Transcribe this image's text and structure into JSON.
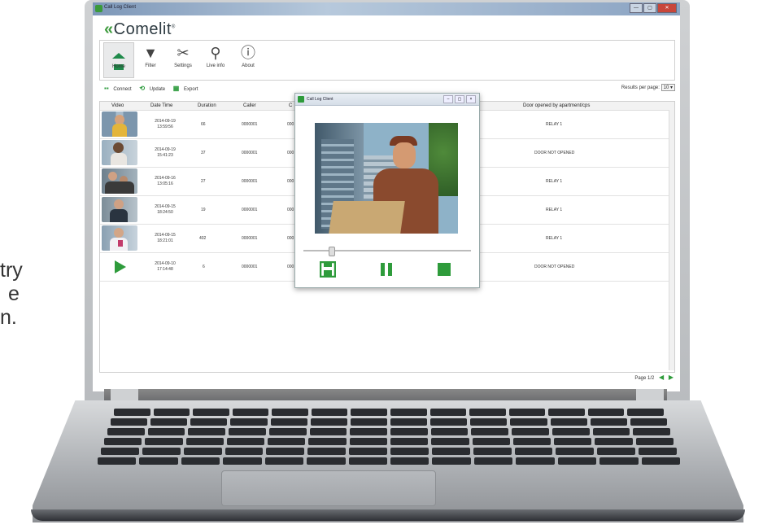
{
  "side_text": {
    "lines": [
      "try",
      "e",
      "n."
    ]
  },
  "window": {
    "title": "Call Log Client",
    "buttons": [
      "—",
      "▢",
      "✕"
    ]
  },
  "brand": {
    "logo": "Comelit",
    "mark": "®"
  },
  "toolbar": {
    "items": [
      {
        "label": "Home",
        "icon": "home-icon",
        "active": true
      },
      {
        "label": "Filter",
        "icon": "filter-icon"
      },
      {
        "label": "Settings",
        "icon": "tools-icon"
      },
      {
        "label": "Live info",
        "icon": "search-icon"
      },
      {
        "label": "About",
        "icon": "info-icon"
      }
    ]
  },
  "actions": {
    "connect": "Connect",
    "update": "Update",
    "export": "Export"
  },
  "results_per_page": {
    "label": "Results per page",
    "value": "10"
  },
  "table": {
    "headers": [
      "Video",
      "Date Time",
      "Duration",
      "Caller",
      "C",
      "Door opened by apartment/cps"
    ],
    "rows": [
      {
        "date": "2014-09-19",
        "time": "13:59:56",
        "duration": "66",
        "caller": "0000001",
        "c": "000",
        "door": "RELAY 1"
      },
      {
        "date": "2014-09-19",
        "time": "15:41:23",
        "duration": "37",
        "caller": "0000001",
        "c": "000",
        "door": "DOOR NOT OPENED"
      },
      {
        "date": "2014-09-16",
        "time": "13:05:16",
        "duration": "27",
        "caller": "0000001",
        "c": "000",
        "door": "RELAY 1"
      },
      {
        "date": "2014-09-15",
        "time": "18:24:50",
        "duration": "19",
        "caller": "0000001",
        "c": "000",
        "door": "RELAY 1"
      },
      {
        "date": "2014-09-15",
        "time": "18:21:01",
        "duration": "402",
        "caller": "0000001",
        "c": "000",
        "door": "RELAY 1"
      },
      {
        "date": "2014-09-10",
        "time": "17:14:48",
        "duration": "6",
        "caller": "0000001",
        "c": "000",
        "door": "DOOR NOT OPENED"
      }
    ]
  },
  "pager": {
    "label": "Page 1/2"
  },
  "popup": {
    "title": "Call Log Client",
    "playback_position": 0.15
  },
  "colors": {
    "accent": "#2e9b3b",
    "text": "#333333"
  }
}
